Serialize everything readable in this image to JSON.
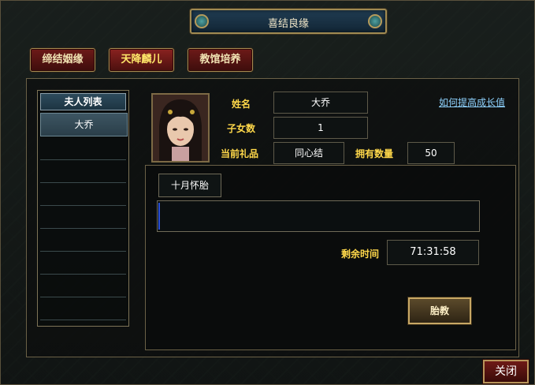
{
  "window": {
    "title": "喜结良缘"
  },
  "tabs": [
    {
      "label": "缔结姻缘",
      "active": false
    },
    {
      "label": "天降麟儿",
      "active": true
    },
    {
      "label": "教馆培养",
      "active": false
    }
  ],
  "wife_list": {
    "header": "夫人列表",
    "items": [
      "大乔"
    ]
  },
  "info": {
    "name_label": "姓名",
    "name_value": "大乔",
    "children_label": "子女数",
    "children_value": "1",
    "gift_label": "当前礼品",
    "gift_value": "同心结",
    "owned_label": "拥有数量",
    "owned_value": "50",
    "growth_link": "如何提高成长值"
  },
  "pregnancy": {
    "stage_label": "十月怀胎",
    "progress": 0.005,
    "remaining_label": "剩余时间",
    "remaining_value": "71:31:58",
    "prenatal_button": "胎教"
  },
  "close_button": "关闭",
  "colors": {
    "label_gold": "#ffd84a",
    "tab_red": "#6d1a18",
    "progress_blue": "#2a50d8",
    "link_blue": "#8fd3ff"
  }
}
